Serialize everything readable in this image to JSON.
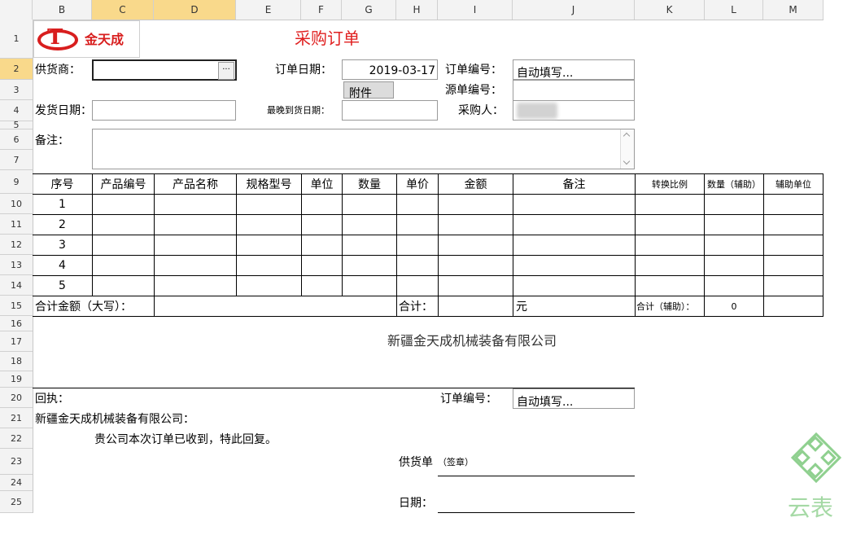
{
  "columns": [
    "B",
    "C",
    "D",
    "E",
    "F",
    "G",
    "H",
    "I",
    "J",
    "K",
    "L",
    "M"
  ],
  "rows": [
    "1",
    "2",
    "3",
    "4",
    "5",
    "6",
    "7",
    "9",
    "10",
    "11",
    "12",
    "13",
    "14",
    "15",
    "16",
    "17",
    "18",
    "19",
    "20",
    "21",
    "22",
    "23",
    "24",
    "25"
  ],
  "form": {
    "logo_text": "金天成",
    "logo_mark": "T",
    "title": "采购订单",
    "supplier_label": "供货商：",
    "supplier_value": "",
    "order_date_label": "订单日期：",
    "order_date_value": "2019-03-17",
    "order_no_label": "订单编号：",
    "order_no_value": "自动填写...",
    "attachment_button": "附件",
    "source_no_label": "源单编号：",
    "ship_date_label": "发货日期：",
    "latest_date_label": "最晚到货日期：",
    "buyer_label": "采购人：",
    "remark_label": "备注：",
    "ellipsis": "···"
  },
  "table": {
    "headers": [
      "序号",
      "产品编号",
      "产品名称",
      "规格型号",
      "单位",
      "数量",
      "单价",
      "金额",
      "备注",
      "转换比例",
      "数量（辅助）",
      "辅助单位"
    ],
    "row_numbers": [
      "1",
      "2",
      "3",
      "4",
      "5"
    ],
    "total_upper_label": "合计金额（大写）：",
    "total_label": "合计：",
    "currency": "元",
    "aux_total_label": "合计（辅助）：",
    "aux_total_value": "0"
  },
  "company_name": "新疆金天成机械装备有限公司",
  "receipt": {
    "label": "回执：",
    "order_no_label": "订单编号：",
    "order_no_value": "自动填写...",
    "company_line": "新疆金天成机械装备有限公司：",
    "message": "贵公司本次订单已收到，特此回复。",
    "supplier_sign_label": "供货单",
    "seal_label": "（签章）",
    "date_label": "日期："
  },
  "watermark": "云表",
  "colors": {
    "title": "#e02020",
    "logo_red": "#d81e1e",
    "header_highlight": "#f9d98b",
    "watermark": "#8fd08f"
  }
}
